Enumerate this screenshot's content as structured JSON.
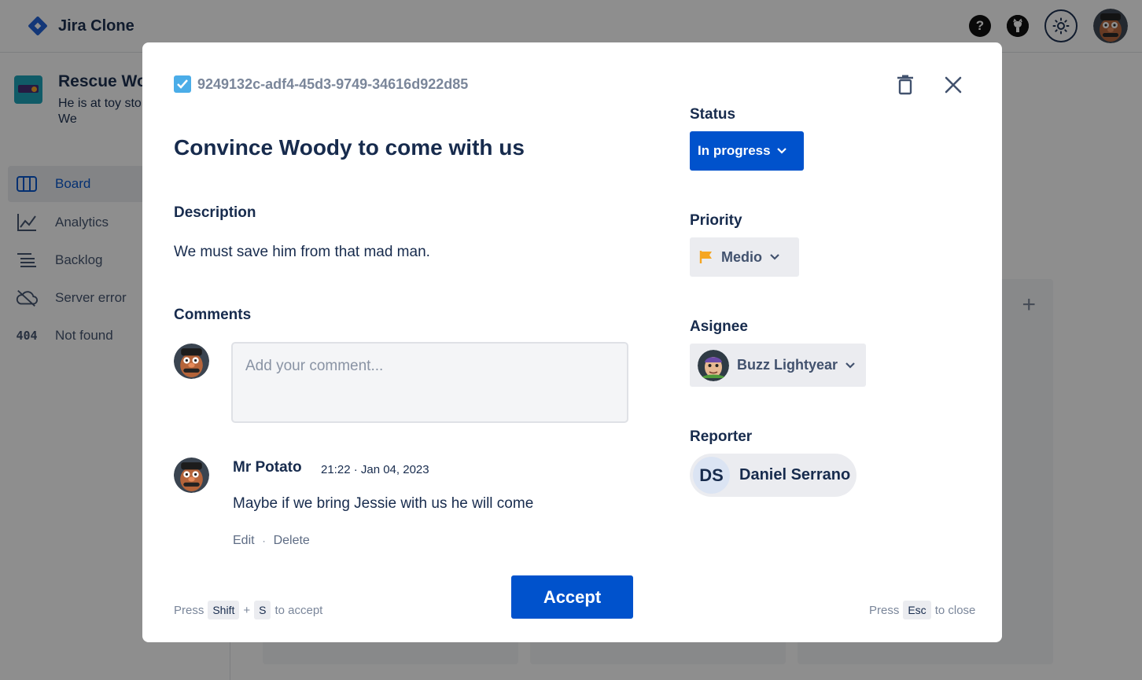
{
  "app": {
    "title": "Jira Clone"
  },
  "topbar": {
    "help_label": "?"
  },
  "project": {
    "name": "Rescue Woody",
    "description": "He is at toy story Toy Barn. We"
  },
  "nav": [
    {
      "label": "Board",
      "icon": "board-icon"
    },
    {
      "label": "Analytics",
      "icon": "chart-icon"
    },
    {
      "label": "Backlog",
      "icon": "list-icon"
    },
    {
      "label": "Server error",
      "icon": "cloud-off-icon"
    },
    {
      "label": "Not found",
      "icon": "404-icon",
      "glyph": "404"
    }
  ],
  "issue": {
    "id": "9249132c-adf4-45d3-9749-34616d922d85",
    "title": "Convince Woody to come with us",
    "description_heading": "Description",
    "description": "We must save him from that mad man.",
    "comments_heading": "Comments",
    "comment_placeholder": "Add your comment...",
    "comments": [
      {
        "author": "Mr Potato",
        "time": "21:22 · Jan 04, 2023",
        "body": "Maybe if we bring Jessie with us he will come",
        "edit_label": "Edit",
        "separator": "·",
        "delete_label": "Delete"
      }
    ]
  },
  "sidepanel": {
    "status_label": "Status",
    "status_value": "In progress",
    "priority_label": "Priority",
    "priority_value": "Medio",
    "assignee_label": "Asignee",
    "assignee_value": "Buzz Lightyear",
    "reporter_label": "Reporter",
    "reporter_initials": "DS",
    "reporter_value": "Daniel Serrano"
  },
  "footer": {
    "accept_label": "Accept",
    "hint_left": {
      "press": "Press",
      "key1": "Shift",
      "plus": "+",
      "key2": "S",
      "suffix": "to accept"
    },
    "hint_right": {
      "press": "Press",
      "key": "Esc",
      "suffix": "to close"
    }
  },
  "colors": {
    "primary": "#0052cc",
    "text": "#172b4d",
    "subtle": "#7a869a",
    "priority_flag": "#f5a623",
    "issue_type": "#4bade8"
  }
}
